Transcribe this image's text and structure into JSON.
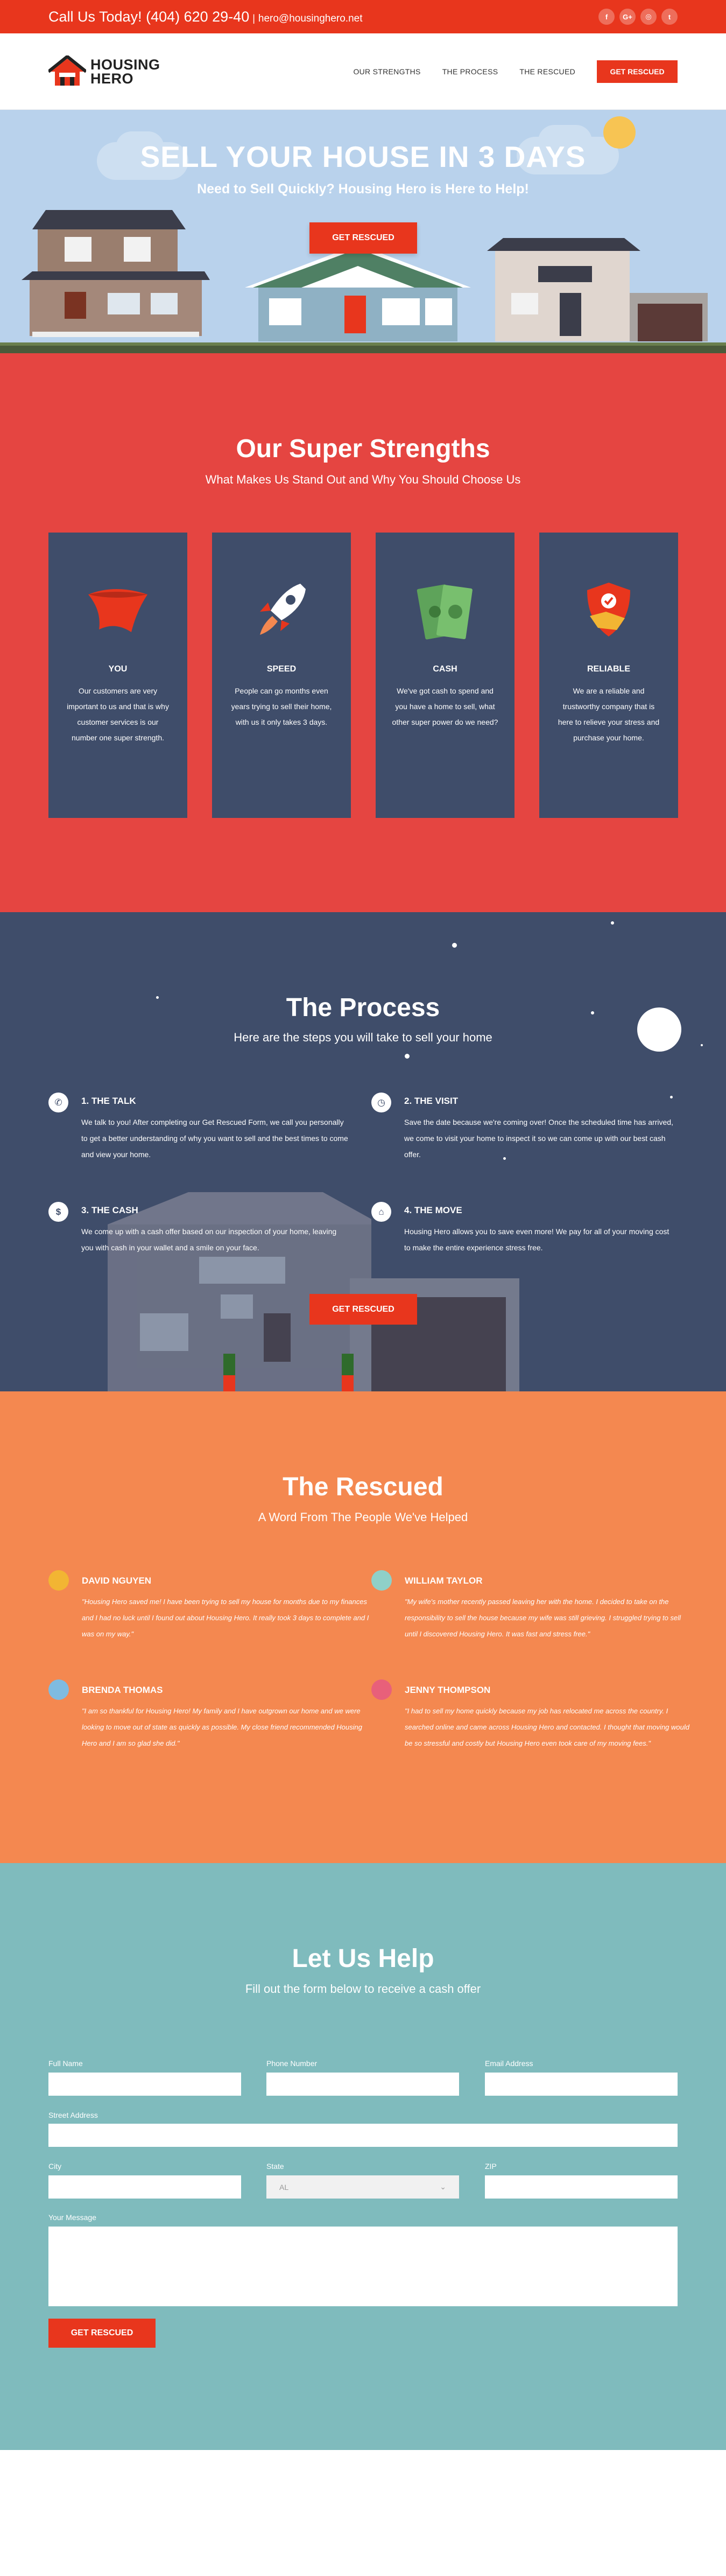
{
  "topbar": {
    "phone": "Call Us Today! (404) 620 29-40",
    "separator": "|",
    "email": "hero@housinghero.net",
    "socials": [
      {
        "icon": "facebook-icon",
        "glyph": "f"
      },
      {
        "icon": "google-plus-icon",
        "glyph": "G+"
      },
      {
        "icon": "instagram-icon",
        "glyph": "◎"
      },
      {
        "icon": "twitter-icon",
        "glyph": "t"
      }
    ]
  },
  "header": {
    "logo_line1": "HOUSING",
    "logo_line2": "HERO",
    "nav": [
      "OUR STRENGTHS",
      "THE PROCESS",
      "THE RESCUED"
    ],
    "cta": "GET RESCUED"
  },
  "hero": {
    "title": "SELL YOUR HOUSE IN 3 DAYS",
    "subtitle": "Need to Sell Quickly? Housing Hero is Here to Help!",
    "cta": "GET RESCUED"
  },
  "strengths": {
    "title": "Our Super Strengths",
    "subtitle": "What Makes Us Stand Out and Why You Should Choose Us",
    "cards": [
      {
        "icon": "cape-icon",
        "title": "YOU",
        "text": "Our customers are very important to us and that is why customer services is our number one super strength."
      },
      {
        "icon": "rocket-icon",
        "title": "SPEED",
        "text": "People can go months even years trying to sell their home, with us it only takes 3 days."
      },
      {
        "icon": "money-icon",
        "title": "CASH",
        "text": "We've got cash to spend and you have a home to sell, what other super power do we need?"
      },
      {
        "icon": "handshake-shield-icon",
        "title": "RELIABLE",
        "text": "We are a reliable and trustworthy company that is here to relieve your stress and purchase your home."
      }
    ]
  },
  "process": {
    "title": "The Process",
    "subtitle": "Here are the steps you will take to sell your home",
    "steps": [
      {
        "icon": "phone-icon",
        "glyph": "✆",
        "title": "1. THE TALK",
        "text": "We talk to you! After completing our Get Rescued Form, we call you personally to get a better understanding of why you want to sell and the best times to come and view your home."
      },
      {
        "icon": "clock-icon",
        "glyph": "◷",
        "title": "2. THE VISIT",
        "text": "Save the date because we're coming over! Once the scheduled time has arrived, we come to visit your home to inspect it so we can come up with our best cash offer."
      },
      {
        "icon": "cash-icon",
        "glyph": "$",
        "title": "3. THE CASH",
        "text": "We come up with a cash offer based on our inspection of your home, leaving you with cash in your wallet and a smile on your face."
      },
      {
        "icon": "home-icon",
        "glyph": "⌂",
        "title": "4. THE MOVE",
        "text": "Housing Hero allows you to save even more! We pay for all of your moving cost to make the entire experience stress free."
      }
    ],
    "cta": "GET RESCUED"
  },
  "rescued": {
    "title": "The Rescued",
    "subtitle": "A Word From The People We've Helped",
    "testimonials": [
      {
        "name": "DAVID NGUYEN",
        "quote": "\"Housing Hero saved me! I have been trying to sell my house for months due to my finances and I had no luck until I found out about Housing Hero. It really took 3 days to complete and I was on my way.\"",
        "avatar_color": "#f2b533"
      },
      {
        "name": "WILLIAM TAYLOR",
        "quote": "\"My wife's mother recently passed leaving her with the home. I decided to take on the responsibility to sell the house because my wife was still grieving. I struggled trying to sell until I discovered Housing Hero. It was fast and stress free.\"",
        "avatar_color": "#8fd0c8"
      },
      {
        "name": "BRENDA THOMAS",
        "quote": "\"I am so thankful for Housing Hero! My family and I have outgrown our home and we were looking to move out of state as quickly as possible. My close friend recommended Housing Hero and I am so glad she did.\"",
        "avatar_color": "#7fbbe0"
      },
      {
        "name": "JENNY THOMPSON",
        "quote": "\"I had to sell my home quickly because my job has relocated me across the country. I searched online and came across Housing Hero and contacted. I thought that moving would be so stressful and costly but Housing Hero even took care of my moving fees.\"",
        "avatar_color": "#e8607a"
      }
    ]
  },
  "help": {
    "title": "Let Us Help",
    "subtitle": "Fill out the form below to receive a cash offer",
    "fields": {
      "full_name": "Full Name",
      "phone": "Phone Number",
      "email": "Email Address",
      "street": "Street Address",
      "city": "City",
      "state": "State",
      "state_value": "AL",
      "zip": "ZIP",
      "message": "Your Message"
    },
    "cta": "GET RESCUED"
  },
  "colors": {
    "brand_red": "#e8361d",
    "strengths_bg": "#e54541",
    "navy": "#3f4d6a",
    "orange": "#f48850",
    "teal": "#7fbbbd",
    "sky": "#b9d2ec"
  }
}
